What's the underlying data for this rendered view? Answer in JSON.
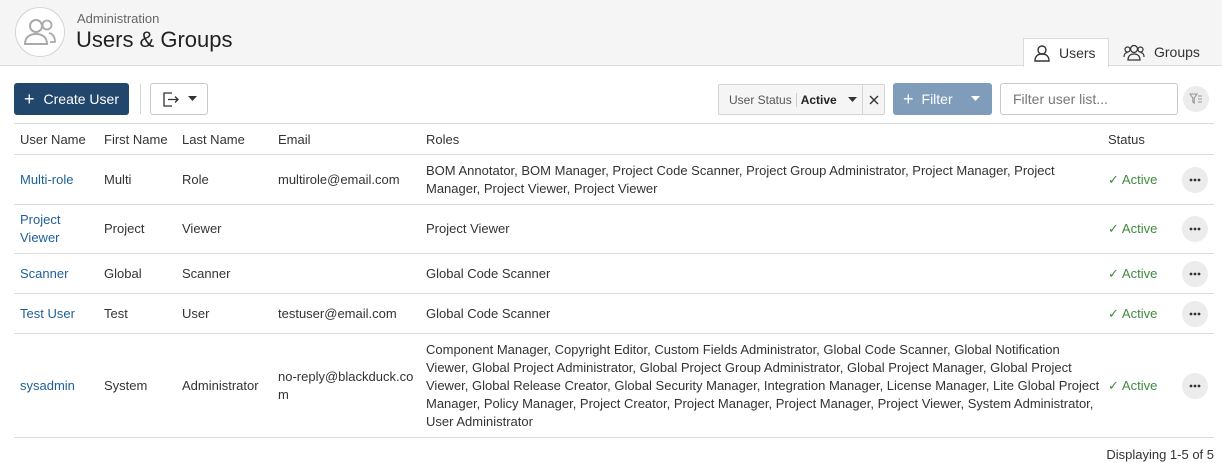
{
  "header": {
    "breadcrumb": "Administration",
    "title": "Users & Groups",
    "tabs": [
      {
        "label": "Users",
        "active": true,
        "icon": "user-icon"
      },
      {
        "label": "Groups",
        "active": false,
        "icon": "users-icon"
      }
    ]
  },
  "toolbar": {
    "create_label": "Create User",
    "status_filter_label": "User Status",
    "status_filter_value": "Active",
    "filter_label": "Filter",
    "search_placeholder": "Filter user list...",
    "accent": "#22476d",
    "filter_color": "#7f9cba"
  },
  "table": {
    "columns": [
      "User Name",
      "First Name",
      "Last Name",
      "Email",
      "Roles",
      "Status"
    ],
    "rows": [
      {
        "username": "Multi-role",
        "first": "Multi",
        "last": "Role",
        "email": "multirole@email.com",
        "roles": "BOM Annotator, BOM Manager, Project Code Scanner, Project Group Administrator, Project Manager, Project Manager, Project Viewer, Project Viewer",
        "status": "Active"
      },
      {
        "username": "Project Viewer",
        "first": "Project",
        "last": "Viewer",
        "email": "",
        "roles": "Project Viewer",
        "status": "Active"
      },
      {
        "username": "Scanner",
        "first": "Global",
        "last": "Scanner",
        "email": "",
        "roles": "Global Code Scanner",
        "status": "Active"
      },
      {
        "username": "Test User",
        "first": "Test",
        "last": "User",
        "email": "testuser@email.com",
        "roles": "Global Code Scanner",
        "status": "Active"
      },
      {
        "username": "sysadmin",
        "first": "System",
        "last": "Administrator",
        "email": "no-reply@blackduck.com",
        "roles": "Component Manager, Copyright Editor, Custom Fields Administrator, Global Code Scanner, Global Notification Viewer, Global Project Administrator, Global Project Group Administrator, Global Project Manager, Global Project Viewer, Global Release Creator, Global Security Manager, Integration Manager, License Manager, Lite Global Project Manager, Policy Manager, Project Creator, Project Manager, Project Manager, Project Viewer, System Administrator, User Administrator",
        "status": "Active"
      }
    ],
    "status_color": "#3f8a3f",
    "link_color": "#1f5f99"
  },
  "footer": {
    "pagination": "Displaying 1-5 of 5"
  }
}
